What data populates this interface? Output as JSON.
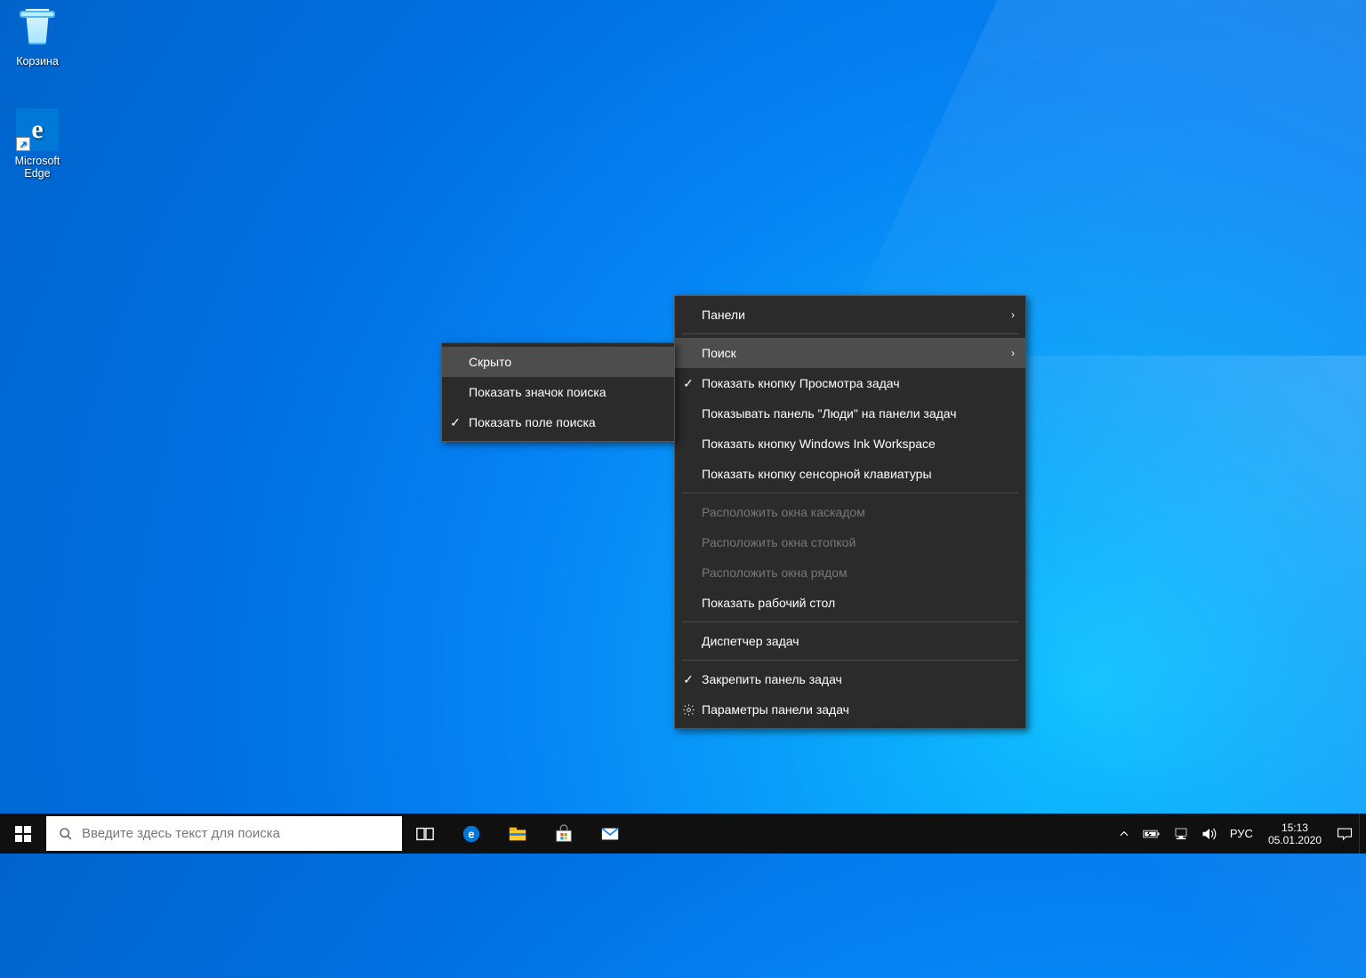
{
  "desktop": {
    "icons": [
      {
        "label": "Корзина"
      },
      {
        "label": "Microsoft\nEdge"
      }
    ]
  },
  "taskbar": {
    "search_placeholder": "Введите здесь текст для поиска",
    "lang": "РУС",
    "time": "15:13",
    "date": "05.01.2020"
  },
  "context_menu": {
    "items": [
      {
        "label": "Панели",
        "submenu": true
      },
      {
        "sep": true
      },
      {
        "label": "Поиск",
        "submenu": true,
        "hover": true
      },
      {
        "label": "Показать кнопку Просмотра задач",
        "checked": true
      },
      {
        "label": "Показывать панель \"Люди\" на панели задач"
      },
      {
        "label": "Показать кнопку Windows Ink Workspace"
      },
      {
        "label": "Показать кнопку сенсорной клавиатуры"
      },
      {
        "sep": true
      },
      {
        "label": "Расположить окна каскадом",
        "disabled": true
      },
      {
        "label": "Расположить окна стопкой",
        "disabled": true
      },
      {
        "label": "Расположить окна рядом",
        "disabled": true
      },
      {
        "label": "Показать рабочий стол"
      },
      {
        "sep": true
      },
      {
        "label": "Диспетчер задач"
      },
      {
        "sep": true
      },
      {
        "label": "Закрепить панель задач",
        "checked": true
      },
      {
        "label": "Параметры панели задач",
        "icon": "gear"
      }
    ]
  },
  "submenu_search": {
    "items": [
      {
        "label": "Скрыто",
        "hover": true
      },
      {
        "label": "Показать значок поиска"
      },
      {
        "label": "Показать поле поиска",
        "checked": true
      }
    ]
  }
}
